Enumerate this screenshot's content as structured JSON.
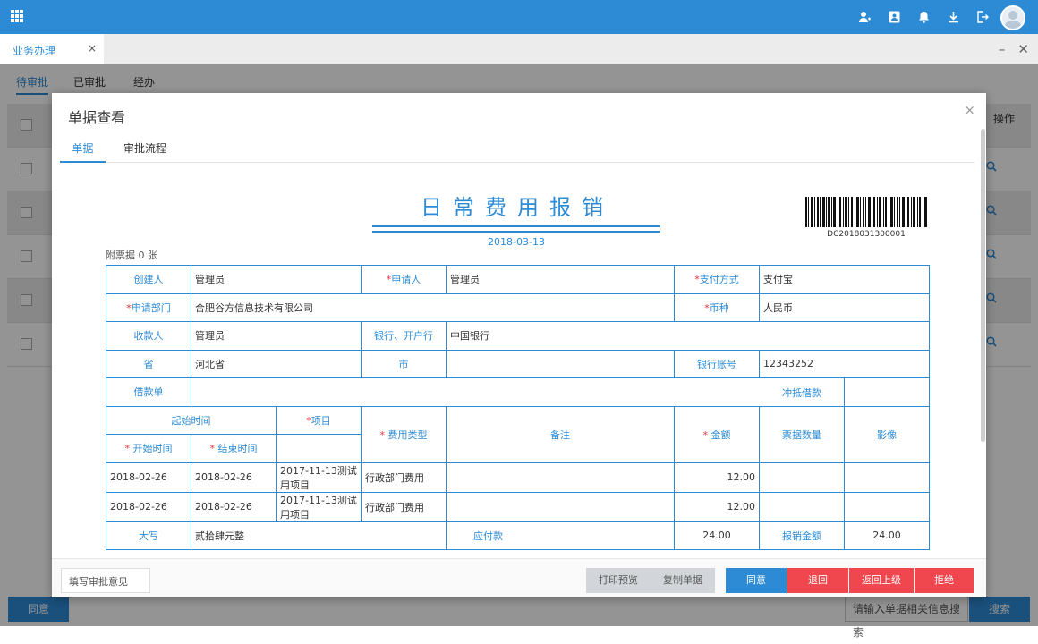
{
  "header": {
    "avatar_label": "user-avatar"
  },
  "window_tab": {
    "label": "业务办理",
    "close": "×"
  },
  "window_controls": {
    "minimize": "–",
    "close": "✕"
  },
  "subtabs": [
    "待审批",
    "已审批",
    "经办"
  ],
  "background": {
    "approve_label": "同意",
    "search_placeholder": "请输入单据相关信息搜索",
    "search_label": "搜索",
    "op_header": "操作"
  },
  "modal": {
    "title": "单据查看",
    "close": "×",
    "tabs": [
      "单据",
      "审批流程"
    ],
    "doc_title": "日常费用报销",
    "doc_date": "2018-03-13",
    "barcode_text": "DC2018031300001",
    "attachments": "附票据 0 张",
    "fields": {
      "creator_label": "创建人",
      "creator": "管理员",
      "applicant_label": "申请人",
      "applicant": "管理员",
      "pay_method_label": "支付方式",
      "pay_method": "支付宝",
      "dept_label": "申请部门",
      "dept": "合肥谷方信息技术有限公司",
      "currency_label": "币种",
      "currency": "人民币",
      "payee_label": "收款人",
      "payee": "管理员",
      "bank_label": "银行、开户行",
      "bank": "中国银行",
      "province_label": "省",
      "province": "河北省",
      "city_label": "市",
      "city": "",
      "account_label": "银行账号",
      "account": "12343252",
      "loan_label": "借款单",
      "loan": "",
      "offset_label": "冲抵借款",
      "offset": ""
    },
    "detail_headers": {
      "period": "起始时间",
      "start": "开始时间",
      "end": "结束时间",
      "project": "项目",
      "fee_type": "费用类型",
      "remark": "备注",
      "amount": "金额",
      "invoice_count": "票据数量",
      "image": "影像"
    },
    "rows": [
      {
        "start": "2018-02-26",
        "end": "2018-02-26",
        "project": "2017-11-13测试用项目",
        "fee_type": "行政部门费用",
        "remark": "",
        "amount": "12.00",
        "count": "",
        "image": ""
      },
      {
        "start": "2018-02-26",
        "end": "2018-02-26",
        "project": "2017-11-13测试用项目",
        "fee_type": "行政部门费用",
        "remark": "",
        "amount": "12.00",
        "count": "",
        "image": ""
      }
    ],
    "totals": {
      "caps_label": "大写",
      "caps": "贰拾肆元整",
      "payable_label": "应付款",
      "payable": "24.00",
      "reimburse_label": "报销金额",
      "reimburse": "24.00"
    },
    "footer": {
      "opinion_placeholder": "填写审批意见",
      "print": "打印预览",
      "copy": "复制单据",
      "agree": "同意",
      "return": "退回",
      "return_up": "返回上级",
      "reject": "拒绝"
    }
  },
  "colors": {
    "primary": "#2d8bd6",
    "danger": "#f0474e",
    "required": "#e0323e"
  }
}
